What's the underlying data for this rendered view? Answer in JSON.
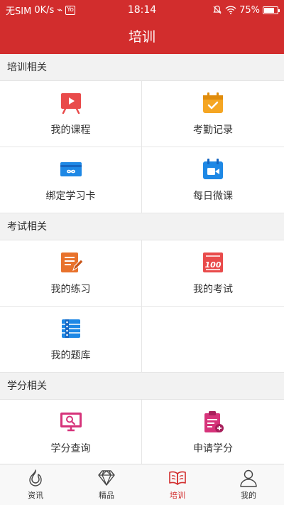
{
  "status_bar": {
    "carrier": "无SIM",
    "speed": "0K/s",
    "badge": "Yo",
    "time": "18:14",
    "battery_text": "75%",
    "battery_level": 0.75
  },
  "header": {
    "title": "培训"
  },
  "sections": [
    {
      "title": "培训相关",
      "items": [
        {
          "label": "我的课程",
          "icon": "video-board-icon"
        },
        {
          "label": "考勤记录",
          "icon": "calendar-check-icon"
        },
        {
          "label": "绑定学习卡",
          "icon": "card-icon"
        },
        {
          "label": "每日微课",
          "icon": "video-camera-icon"
        }
      ]
    },
    {
      "title": "考试相关",
      "items": [
        {
          "label": "我的练习",
          "icon": "notepad-pencil-icon"
        },
        {
          "label": "我的考试",
          "icon": "score-100-icon"
        },
        {
          "label": "我的题库",
          "icon": "question-bank-icon"
        }
      ]
    },
    {
      "title": "学分相关",
      "items": [
        {
          "label": "学分查询",
          "icon": "monitor-search-icon"
        },
        {
          "label": "申请学分",
          "icon": "clipboard-apply-icon"
        }
      ]
    }
  ],
  "tabbar": [
    {
      "label": "资讯",
      "icon": "flame-icon"
    },
    {
      "label": "精品",
      "icon": "diamond-icon"
    },
    {
      "label": "培训",
      "icon": "book-icon",
      "active": true
    },
    {
      "label": "我的",
      "icon": "user-icon"
    }
  ],
  "colors": {
    "brand": "#d22d2d",
    "icon_red": "#e94b4b",
    "icon_yellow": "#f5a623",
    "icon_blue": "#1e88e5",
    "icon_orange": "#e8722c",
    "icon_pink": "#d6337a"
  }
}
